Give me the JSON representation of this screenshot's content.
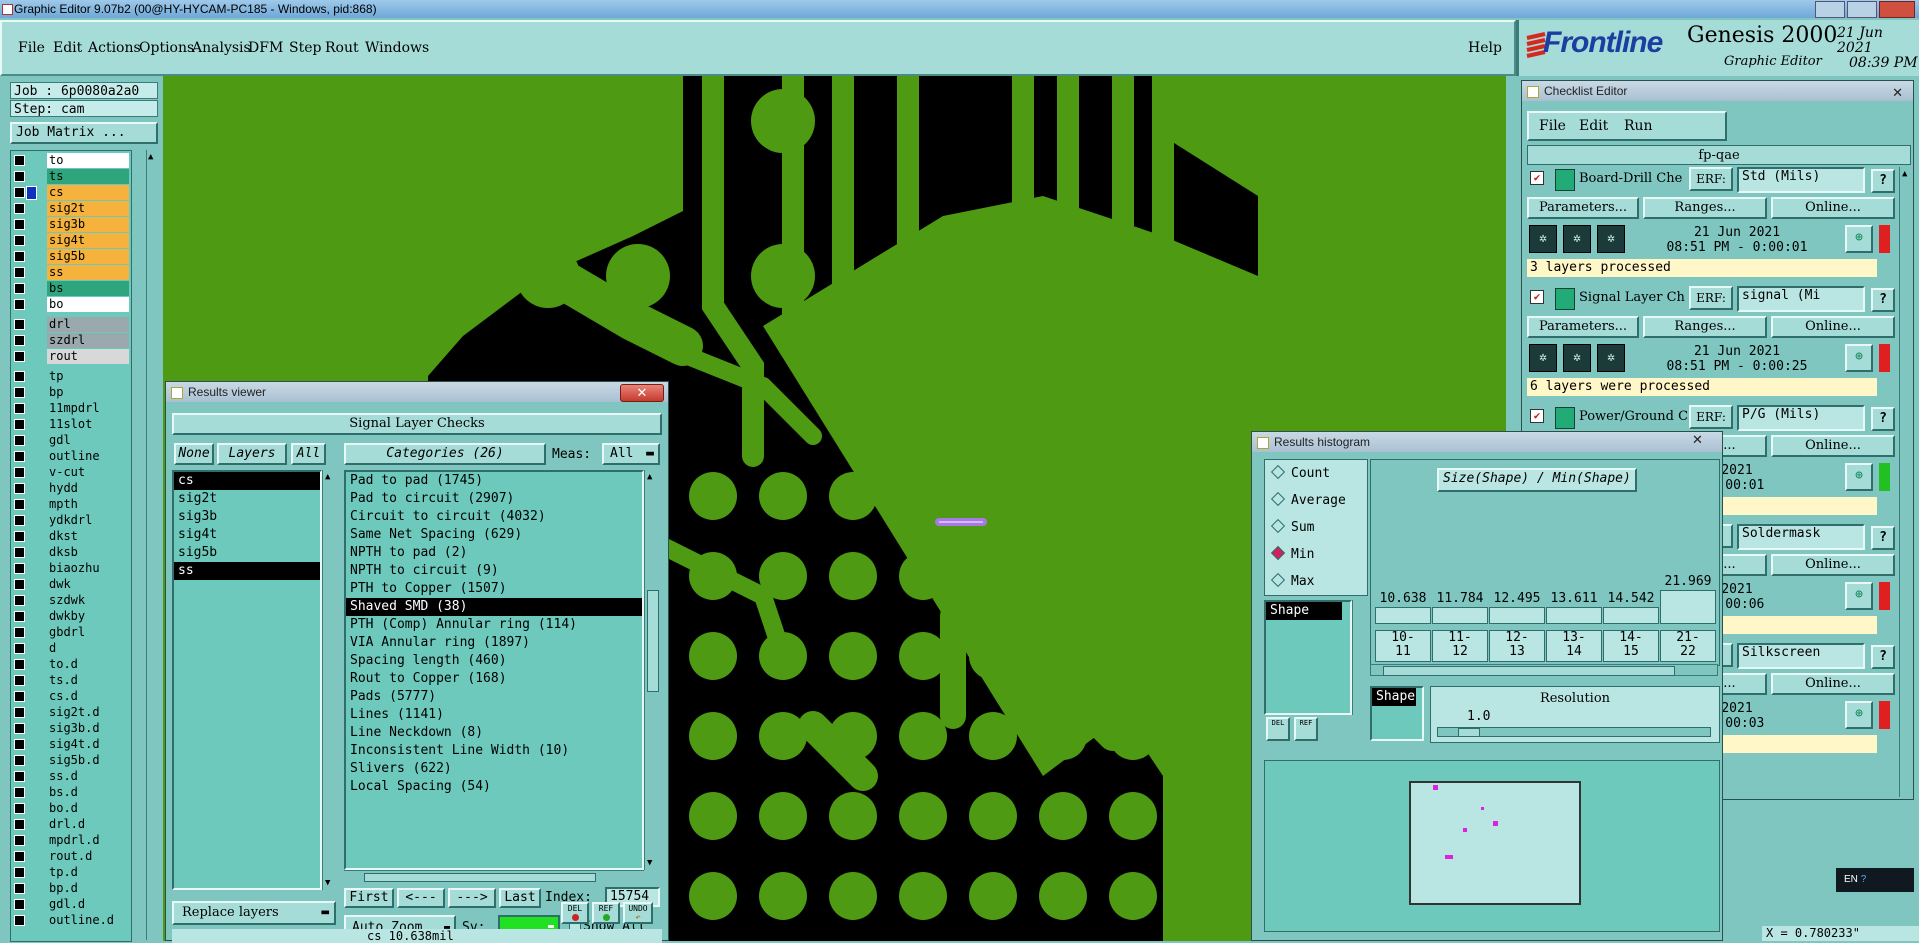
{
  "window_title": "Graphic Editor 9.07b2 (00@HY-HYCAM-PC185 - Windows, pid:868)",
  "menu": [
    "File",
    "Edit",
    "Actions",
    "Options",
    "Analysis",
    "DFM",
    "Step",
    "Rout",
    "Windows"
  ],
  "help": "Help",
  "logo": {
    "brand": "Frontline",
    "product": "Genesis 2000",
    "subtitle": "Graphic Editor",
    "date": "21 Jun 2021",
    "time": "08:39 PM"
  },
  "left": {
    "job": "Job : 6p0080a2a0",
    "step": "Step: cam",
    "job_matrix": "Job Matrix ...",
    "layers": [
      {
        "name": "to",
        "color": "#ffffff",
        "mark": "◆"
      },
      {
        "name": "ts",
        "color": "#2fa57e",
        "mark": ""
      },
      {
        "name": "cs",
        "color": "#f5b23c",
        "mark": "■"
      },
      {
        "name": "sig2t",
        "color": "#f5b23c",
        "mark": ""
      },
      {
        "name": "sig3b",
        "color": "#f5b23c",
        "mark": ""
      },
      {
        "name": "sig4t",
        "color": "#f5b23c",
        "mark": ""
      },
      {
        "name": "sig5b",
        "color": "#f5b23c",
        "mark": ""
      },
      {
        "name": "ss",
        "color": "#f5b23c",
        "mark": ""
      },
      {
        "name": "bs",
        "color": "#2fa57e",
        "mark": ""
      },
      {
        "name": "bo",
        "color": "#ffffff",
        "mark": "◆"
      },
      {
        "name": "drl",
        "color": "#9aa9ad",
        "mark": ""
      },
      {
        "name": "szdrl",
        "color": "#9aa9ad",
        "mark": ""
      },
      {
        "name": "rout",
        "color": "#d8d8d8",
        "mark": ""
      },
      {
        "name": "tp",
        "color": "#6ec9bd",
        "mark": ""
      },
      {
        "name": "bp",
        "color": "#6ec9bd",
        "mark": ""
      },
      {
        "name": "11mpdrl",
        "color": "#6ec9bd",
        "mark": ""
      },
      {
        "name": "11slot",
        "color": "#6ec9bd",
        "mark": ""
      },
      {
        "name": "gdl",
        "color": "#6ec9bd",
        "mark": ""
      },
      {
        "name": "outline",
        "color": "#6ec9bd",
        "mark": ""
      },
      {
        "name": "v-cut",
        "color": "#6ec9bd",
        "mark": ""
      },
      {
        "name": "hydd",
        "color": "#6ec9bd",
        "mark": ""
      },
      {
        "name": "mpth",
        "color": "#6ec9bd",
        "mark": ""
      },
      {
        "name": "ydkdrl",
        "color": "#6ec9bd",
        "mark": ""
      },
      {
        "name": "dkst",
        "color": "#6ec9bd",
        "mark": ""
      },
      {
        "name": "dksb",
        "color": "#6ec9bd",
        "mark": ""
      },
      {
        "name": "biaozhu",
        "color": "#6ec9bd",
        "mark": ""
      },
      {
        "name": "dwk",
        "color": "#6ec9bd",
        "mark": ""
      },
      {
        "name": "szdwk",
        "color": "#6ec9bd",
        "mark": ""
      },
      {
        "name": "dwkby",
        "color": "#6ec9bd",
        "mark": ""
      },
      {
        "name": "gbdrl",
        "color": "#6ec9bd",
        "mark": ""
      },
      {
        "name": "d",
        "color": "#6ec9bd",
        "mark": ""
      },
      {
        "name": "to.d",
        "color": "#6ec9bd",
        "mark": "◆"
      },
      {
        "name": "ts.d",
        "color": "#6ec9bd",
        "mark": ""
      },
      {
        "name": "cs.d",
        "color": "#6ec9bd",
        "mark": ""
      },
      {
        "name": "sig2t.d",
        "color": "#6ec9bd",
        "mark": ""
      },
      {
        "name": "sig3b.d",
        "color": "#6ec9bd",
        "mark": ""
      },
      {
        "name": "sig4t.d",
        "color": "#6ec9bd",
        "mark": ""
      },
      {
        "name": "sig5b.d",
        "color": "#6ec9bd",
        "mark": ""
      },
      {
        "name": "ss.d",
        "color": "#6ec9bd",
        "mark": ""
      },
      {
        "name": "bs.d",
        "color": "#6ec9bd",
        "mark": ""
      },
      {
        "name": "bo.d",
        "color": "#6ec9bd",
        "mark": "◆"
      },
      {
        "name": "drl.d",
        "color": "#6ec9bd",
        "mark": ""
      },
      {
        "name": "mpdrl.d",
        "color": "#6ec9bd",
        "mark": ""
      },
      {
        "name": "rout.d",
        "color": "#6ec9bd",
        "mark": ""
      },
      {
        "name": "tp.d",
        "color": "#6ec9bd",
        "mark": ""
      },
      {
        "name": "bp.d",
        "color": "#6ec9bd",
        "mark": ""
      },
      {
        "name": "gdl.d",
        "color": "#6ec9bd",
        "mark": ""
      },
      {
        "name": "outline.d",
        "color": "#6ec9bd",
        "mark": ""
      }
    ]
  },
  "results_viewer": {
    "title": "Results viewer",
    "header": "Signal Layer Checks",
    "none": "None",
    "layers": "Layers",
    "all": "All",
    "categories_label": "Categories (26)",
    "meas": "Meas:",
    "meas_value": "All",
    "layer_list": [
      "cs",
      "sig2t",
      "sig3b",
      "sig4t",
      "sig5b",
      "ss"
    ],
    "categories": [
      "Pad to pad (1745)",
      "Pad to circuit (2907)",
      "Circuit to circuit (4032)",
      "Same Net Spacing (629)",
      "NPTH to pad (2)",
      "NPTH to circuit (9)",
      "PTH to Copper (1507)",
      "Shaved SMD (38)",
      "PTH (Comp) Annular ring (114)",
      "VIA Annular ring (1897)",
      "Spacing length (460)",
      "Rout to Copper (168)",
      "Pads (5777)",
      "Lines (1141)",
      "Line Neckdown (8)",
      "Inconsistent Line Width (10)",
      "Slivers (622)",
      "Local Spacing (54)"
    ],
    "first": "First",
    "prev": "<---",
    "next": "--->",
    "last": "Last",
    "index_label": "Index:",
    "index_value": "15754",
    "auto_zoom": "Auto Zoom",
    "sv": "Sv:",
    "show_all": "Show All",
    "replace_layers": "Replace layers",
    "del": "DEL",
    "ref": "REF",
    "undo": "UNDO",
    "status": "cs 10.638mil"
  },
  "histogram": {
    "title": "Results histogram",
    "modes": [
      "Count",
      "Average",
      "Sum",
      "Min",
      "Max"
    ],
    "selected_mode": "Min",
    "attr": "Shape",
    "chart_title": "Size(Shape) / Min(Shape)",
    "bar_values": [
      "10.638",
      "11.784",
      "12.495",
      "13.611",
      "14.542",
      "21.969"
    ],
    "bin_labels": [
      "10-\n11",
      "11-\n12",
      "12-\n13",
      "13-\n14",
      "14-\n15",
      "21-\n22"
    ],
    "resolution_label": "Resolution",
    "resolution_value": "1.0",
    "footer_left": "20",
    "footer_mid": "--- (. 0 l"
  },
  "checklist": {
    "title": "Checklist Editor",
    "menu": [
      "File",
      "Edit",
      "Run"
    ],
    "name": "fp-qae",
    "items": [
      {
        "name": "Board-Drill Che",
        "erf": "ERF:",
        "erf_value": "Std (Mils)",
        "date": "21 Jun 2021",
        "time": "08:51 PM - 0:00:01",
        "status": "3 layers processed",
        "bar": "red"
      },
      {
        "name": "Signal Layer Ch",
        "erf": "ERF:",
        "erf_value": "signal (Mi",
        "date": "21 Jun 2021",
        "time": "08:51 PM - 0:00:25",
        "status": "6 layers were processed",
        "bar": "red"
      },
      {
        "name": "Power/Ground C",
        "erf": "ERF:",
        "erf_value": "P/G (Mils)",
        "date": "2021",
        "time": "0:00:01",
        "status": "processed",
        "bar": "green"
      },
      {
        "name": "",
        "erf": "",
        "erf_value": "Soldermask",
        "date": "2021",
        "time": "0:00:06",
        "status": "ere processed",
        "bar": "red"
      },
      {
        "name": "",
        "erf": "",
        "erf_value": "Silkscreen",
        "date": "2021",
        "time": "0:00:03",
        "status": "rocessed",
        "bar": "red"
      }
    ],
    "parameters": "Parameters...",
    "ranges": "Ranges...",
    "online": "Online..."
  },
  "coords": "X = 0.780233\"",
  "lang": "EN"
}
